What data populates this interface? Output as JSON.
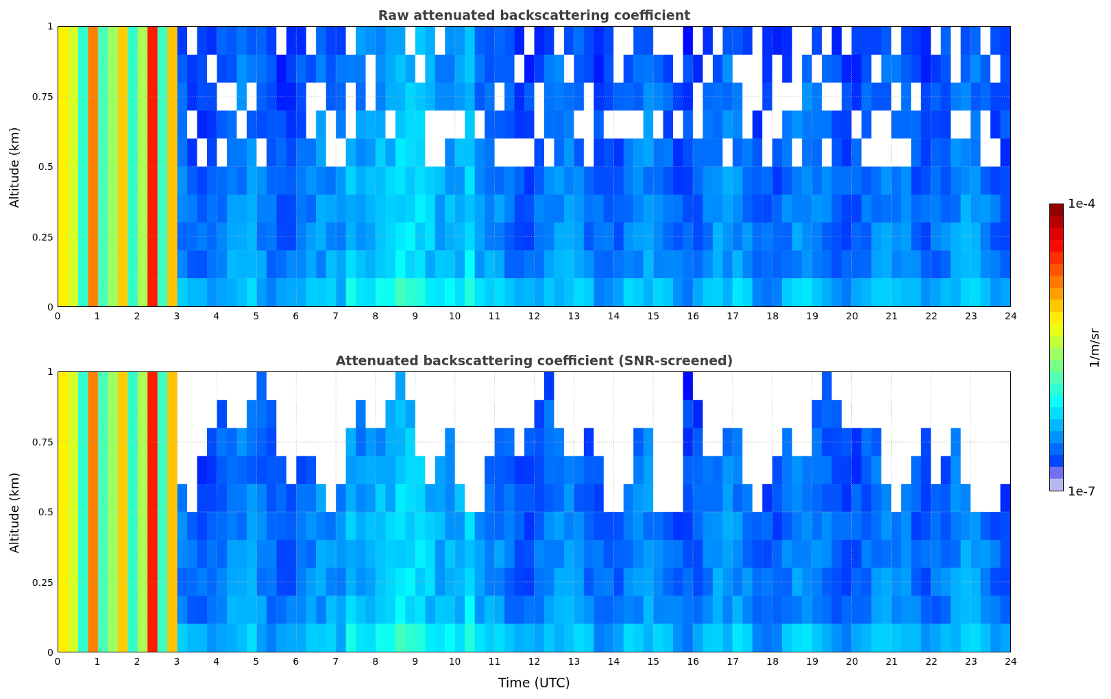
{
  "panels": [
    {
      "title": "Raw attenuated backscattering coefficient",
      "kind": "raw",
      "ylabel": "Altitude (km)",
      "yticks": [
        "1",
        "0.75",
        "0.5",
        "0.25",
        "0"
      ],
      "xticks": [
        "0",
        "1",
        "2",
        "3",
        "4",
        "5",
        "6",
        "7",
        "8",
        "9",
        "10",
        "11",
        "12",
        "13",
        "14",
        "15",
        "16",
        "17",
        "18",
        "19",
        "20",
        "21",
        "22",
        "23",
        "24"
      ]
    },
    {
      "title": "Attenuated backscattering coefficient (SNR-screened)",
      "kind": "screened",
      "ylabel": "Altitude (km)",
      "yticks": [
        "1",
        "0.75",
        "0.5",
        "0.25",
        "0"
      ],
      "xticks": [
        "0",
        "1",
        "2",
        "3",
        "4",
        "5",
        "6",
        "7",
        "8",
        "9",
        "10",
        "11",
        "12",
        "13",
        "14",
        "15",
        "16",
        "17",
        "18",
        "19",
        "20",
        "21",
        "22",
        "23",
        "24"
      ],
      "xlabel": "Time (UTC)"
    }
  ],
  "colorbar": {
    "max": "1e-4",
    "min": "1e-7",
    "label": "1/m/sr"
  }
}
